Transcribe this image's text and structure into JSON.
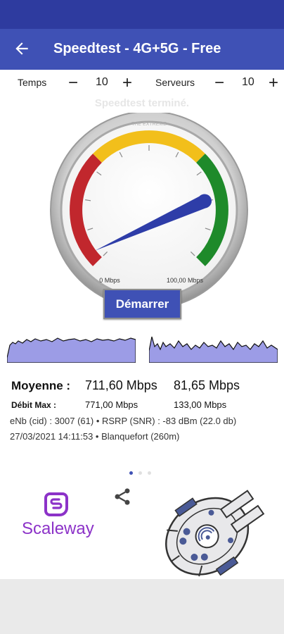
{
  "appbar": {
    "title": "Speedtest - 4G+5G - Free",
    "back_icon": "arrow-left-icon"
  },
  "controls": {
    "time_label": "Temps",
    "time_value": "10",
    "servers_label": "Serveurs",
    "servers_value": "10",
    "minus": "−",
    "plus": "+"
  },
  "status": {
    "message": "Speedtest terminé."
  },
  "gauge": {
    "brand": "THE EXTREME",
    "min_label": "0 Mbps",
    "max_label": "100,00 Mbps",
    "needle_fraction": 0.8,
    "colors": {
      "red": "#c1272d",
      "yellow": "#f2bf1b",
      "green": "#1e8a2a",
      "needle": "#2e3da8"
    }
  },
  "start_button": {
    "label": "Démarrer"
  },
  "results": {
    "average_label": "Moyenne :",
    "average_down": "711,60 Mbps",
    "average_up": "81,65 Mbps",
    "max_label": "Débit Max :",
    "max_down": "771,00 Mbps",
    "max_up": "133,00 Mbps",
    "cell_info": "eNb (cid) : 3007 (61)  •  RSRP (SNR) : -83 dBm (22.0 db)",
    "time_location": "27/03/2021 14:11:53  •  Blanquefort (260m)"
  },
  "pager": {
    "pages": 3,
    "active": 0
  },
  "sponsor": {
    "name": "Scaleway",
    "color": "#8c32c8"
  },
  "icons": {
    "share": "share-icon",
    "ship": "spaceship-icon"
  }
}
